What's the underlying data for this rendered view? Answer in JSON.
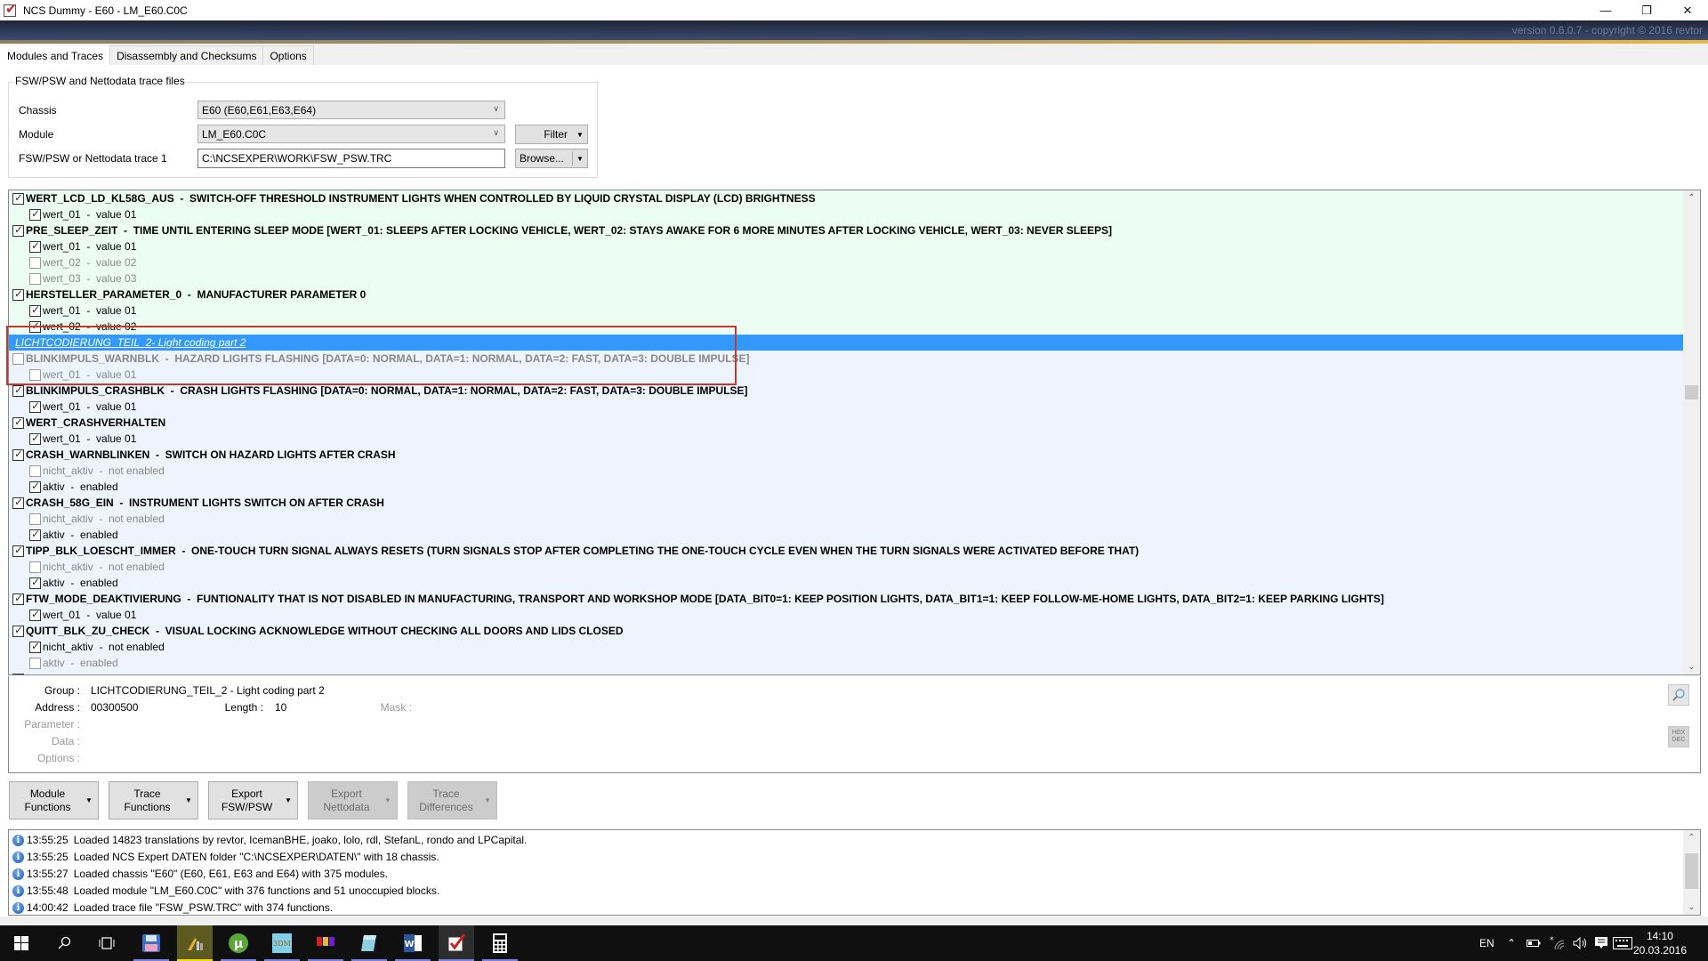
{
  "window": {
    "title": "NCS Dummy - E60 - LM_E60.C0C",
    "version_text": "version 0.6.0.7 - copyright © 2016 revtor",
    "controls": {
      "minimize": "—",
      "restore": "❐",
      "close": "✕"
    }
  },
  "tabs": [
    {
      "label": "Modules and Traces",
      "active": true
    },
    {
      "label": "Disassembly and Checksums",
      "active": false
    },
    {
      "label": "Options",
      "active": false
    }
  ],
  "trace_files": {
    "group_title": "FSW/PSW and Nettodata trace files",
    "chassis_label": "Chassis",
    "chassis_value": "E60  (E60,E61,E63,E64)",
    "module_label": "Module",
    "module_value": "LM_E60.C0C",
    "trace_label": "FSW/PSW or Nettodata trace 1",
    "trace_value": "C:\\NCSEXPER\\WORK\\FSW_PSW.TRC",
    "filter_button": "Filter",
    "browse_button": "Browse..."
  },
  "tree": {
    "rows": [
      {
        "type": "fn",
        "name": "WERT_LCD_LD_KL58G_AUS",
        "desc": "SWITCH-OFF THRESHOLD INSTRUMENT LIGHTS WHEN CONTROLLED BY LIQUID CRYSTAL DISPLAY (LCD) BRIGHTNESS",
        "checked": true,
        "disabled": false,
        "bg": "green"
      },
      {
        "type": "val",
        "name": "wert_01",
        "desc": "value 01",
        "checked": true,
        "disabled": false,
        "bg": "green"
      },
      {
        "type": "fn",
        "name": "PRE_SLEEP_ZEIT",
        "desc": "TIME UNTIL ENTERING SLEEP MODE [WERT_01: SLEEPS AFTER LOCKING VEHICLE, WERT_02: STAYS AWAKE FOR 6 MORE MINUTES AFTER LOCKING VEHICLE, WERT_03: NEVER SLEEPS]",
        "checked": true,
        "disabled": false,
        "bg": "green"
      },
      {
        "type": "val",
        "name": "wert_01",
        "desc": "value 01",
        "checked": true,
        "disabled": false,
        "bg": "green"
      },
      {
        "type": "val",
        "name": "wert_02",
        "desc": "value 02",
        "checked": false,
        "disabled": true,
        "bg": "green"
      },
      {
        "type": "val",
        "name": "wert_03",
        "desc": "value 03",
        "checked": false,
        "disabled": true,
        "bg": "green"
      },
      {
        "type": "fn",
        "name": "HERSTELLER_PARAMETER_0",
        "desc": "MANUFACTURER PARAMETER 0",
        "checked": true,
        "disabled": false,
        "bg": "green"
      },
      {
        "type": "val",
        "name": "wert_01",
        "desc": "value 01",
        "checked": true,
        "disabled": false,
        "bg": "green"
      },
      {
        "type": "val",
        "name": "wert_02",
        "desc": "value 02",
        "checked": true,
        "disabled": false,
        "bg": "green"
      },
      {
        "type": "group",
        "name": "LICHTCODIERUNG_TEIL_2",
        "desc": "Light coding part 2",
        "selected": true
      },
      {
        "type": "fn",
        "name": "BLINKIMPULS_WARNBLK",
        "desc": "HAZARD LIGHTS FLASHING [DATA=0: NORMAL, DATA=1: NORMAL, DATA=2: FAST, DATA=3: DOUBLE IMPULSE]",
        "checked": false,
        "disabled": true,
        "bg": "blue"
      },
      {
        "type": "val",
        "name": "wert_01",
        "desc": "value 01",
        "checked": false,
        "disabled": true,
        "bg": "blue"
      },
      {
        "type": "fn",
        "name": "BLINKIMPULS_CRASHBLK",
        "desc": "CRASH LIGHTS FLASHING [DATA=0: NORMAL, DATA=1: NORMAL, DATA=2: FAST, DATA=3: DOUBLE IMPULSE]",
        "checked": true,
        "disabled": false,
        "bg": "blue"
      },
      {
        "type": "val",
        "name": "wert_01",
        "desc": "value 01",
        "checked": true,
        "disabled": false,
        "bg": "blue"
      },
      {
        "type": "fn",
        "name": "WERT_CRASHVERHALTEN",
        "desc": "",
        "checked": true,
        "disabled": false,
        "bg": "blue"
      },
      {
        "type": "val",
        "name": "wert_01",
        "desc": "value 01",
        "checked": true,
        "disabled": false,
        "bg": "blue"
      },
      {
        "type": "fn",
        "name": "CRASH_WARNBLINKEN",
        "desc": "SWITCH ON HAZARD LIGHTS AFTER CRASH",
        "checked": true,
        "disabled": false,
        "bg": "blue"
      },
      {
        "type": "val",
        "name": "nicht_aktiv",
        "desc": "not enabled",
        "checked": false,
        "disabled": true,
        "bg": "blue"
      },
      {
        "type": "val",
        "name": "aktiv",
        "desc": "enabled",
        "checked": true,
        "disabled": false,
        "bg": "blue"
      },
      {
        "type": "fn",
        "name": "CRASH_58G_EIN",
        "desc": "INSTRUMENT LIGHTS SWITCH ON AFTER CRASH",
        "checked": true,
        "disabled": false,
        "bg": "blue"
      },
      {
        "type": "val",
        "name": "nicht_aktiv",
        "desc": "not enabled",
        "checked": false,
        "disabled": true,
        "bg": "blue"
      },
      {
        "type": "val",
        "name": "aktiv",
        "desc": "enabled",
        "checked": true,
        "disabled": false,
        "bg": "blue"
      },
      {
        "type": "fn",
        "name": "TIPP_BLK_LOESCHT_IMMER",
        "desc": "ONE-TOUCH TURN SIGNAL ALWAYS RESETS (TURN SIGNALS STOP AFTER COMPLETING THE ONE-TOUCH CYCLE EVEN WHEN THE TURN SIGNALS WERE ACTIVATED BEFORE THAT)",
        "checked": true,
        "disabled": false,
        "bg": "blue"
      },
      {
        "type": "val",
        "name": "nicht_aktiv",
        "desc": "not enabled",
        "checked": false,
        "disabled": true,
        "bg": "blue"
      },
      {
        "type": "val",
        "name": "aktiv",
        "desc": "enabled",
        "checked": true,
        "disabled": false,
        "bg": "blue"
      },
      {
        "type": "fn",
        "name": "FTW_MODE_DEAKTIVIERUNG",
        "desc": "FUNTIONALITY THAT IS NOT DISABLED IN MANUFACTURING, TRANSPORT AND WORKSHOP MODE [DATA_BIT0=1: KEEP POSITION LIGHTS, DATA_BIT1=1: KEEP FOLLOW-ME-HOME LIGHTS, DATA_BIT2=1: KEEP PARKING LIGHTS]",
        "checked": true,
        "disabled": false,
        "bg": "blue"
      },
      {
        "type": "val",
        "name": "wert_01",
        "desc": "value 01",
        "checked": true,
        "disabled": false,
        "bg": "blue"
      },
      {
        "type": "fn",
        "name": "QUITT_BLK_ZU_CHECK",
        "desc": "VISUAL LOCKING ACKNOWLEDGE WITHOUT CHECKING ALL DOORS AND LIDS CLOSED",
        "checked": true,
        "disabled": false,
        "bg": "blue"
      },
      {
        "type": "val",
        "name": "nicht_aktiv",
        "desc": "not enabled",
        "checked": true,
        "disabled": false,
        "bg": "blue"
      },
      {
        "type": "val",
        "name": "aktiv",
        "desc": "enabled",
        "checked": false,
        "disabled": true,
        "bg": "blue"
      }
    ],
    "separator": "-"
  },
  "details": {
    "group_label": "Group :",
    "group_value": "LICHTCODIERUNG_TEIL_2  -  Light coding part 2",
    "address_label": "Address :",
    "address_value": "00300500",
    "length_label": "Length :",
    "length_value": "10",
    "mask_label": "Mask :",
    "parameter_label": "Parameter :",
    "data_label": "Data :",
    "options_label": "Options :",
    "hex_label": "HEX",
    "dec_label": "DEC"
  },
  "action_buttons": [
    {
      "line1": "Module",
      "line2": "Functions",
      "enabled": true
    },
    {
      "line1": "Trace",
      "line2": "Functions",
      "enabled": true
    },
    {
      "line1": "Export",
      "line2": "FSW/PSW",
      "enabled": true
    },
    {
      "line1": "Export",
      "line2": "Nettodata",
      "enabled": false
    },
    {
      "line1": "Trace",
      "line2": "Differences",
      "enabled": false
    }
  ],
  "log": [
    {
      "time": "13:55:25",
      "message": "Loaded 14823 translations by revtor, IcemanBHE, joako, lolo, rdl, StefanL, rondo and LPCapital."
    },
    {
      "time": "13:55:25",
      "message": "Loaded NCS Expert DATEN folder \"C:\\NCSEXPER\\DATEN\\\" with 18 chassis."
    },
    {
      "time": "13:55:27",
      "message": "Loaded chassis \"E60\" (E60, E61, E63 and E64) with 375 modules."
    },
    {
      "time": "13:55:48",
      "message": "Loaded module \"LM_E60.C0C\" with 376 functions and 51 unoccupied blocks."
    },
    {
      "time": "14:00:42",
      "message": "Loaded trace file \"FSW_PSW.TRC\" with 374 functions."
    }
  ],
  "taskbar": {
    "apps": [
      "start",
      "search",
      "task-view",
      "save-app",
      "tool-app",
      "utorrent",
      "3dm-app",
      "gabi-app",
      "notepad-app",
      "word-app",
      "ncs-dummy-app",
      "calculator-app"
    ],
    "language": "EN",
    "time": "14:10",
    "date": "20.03.2016"
  },
  "colors": {
    "selection": "#3399ff",
    "green_rows": "#ecfdf4",
    "blue_rows": "#edf4fe",
    "highlight_box": "#c0392b"
  }
}
